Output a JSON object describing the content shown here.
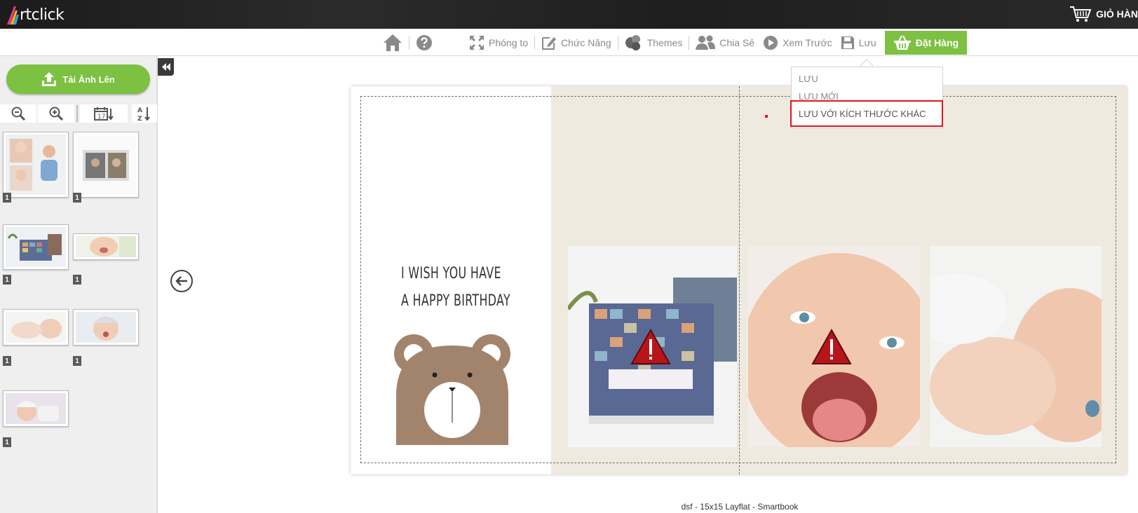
{
  "app": {
    "logo_text": "rtclick",
    "cart_label": "GIỎ HÀN"
  },
  "toolbar": {
    "zoom_label": "Phóng to",
    "function_label": "Chức Năng",
    "themes_label": "Themes",
    "share_label": "Chia Sẻ",
    "preview_label": "Xem Trước",
    "save_label": "Lưu",
    "order_label": "Đặt Hàng"
  },
  "save_menu": {
    "items": [
      "LƯU",
      "LƯU MỚI",
      "LƯU VỚI KÍCH THƯỚC KHÁC"
    ],
    "highlighted_index": 2
  },
  "sidebar": {
    "upload_label": "Tải Ảnh Lên",
    "photos": [
      {
        "count": "1",
        "icon": "baby-collage-photo"
      },
      {
        "count": "1",
        "icon": "photo-book-photo"
      },
      {
        "count": "1",
        "icon": "photo-book-open-photo"
      },
      {
        "count": "1",
        "icon": "baby-smiling-photo"
      },
      {
        "count": "1",
        "icon": "baby-lying-photo"
      },
      {
        "count": "1",
        "icon": "baby-surprised-photo"
      },
      {
        "count": "1",
        "icon": "baby-hat-photo"
      }
    ]
  },
  "page": {
    "greeting_line1": "I WISH YOU HAVE",
    "greeting_line2": "A HAPPY BIRTHDAY",
    "book_caption": "dsf - 15x15 Layflat - Smartbook"
  },
  "colors": {
    "accent_green": "#7cc142",
    "highlight_red": "#e3141c",
    "page_beige": "#efeadf"
  }
}
